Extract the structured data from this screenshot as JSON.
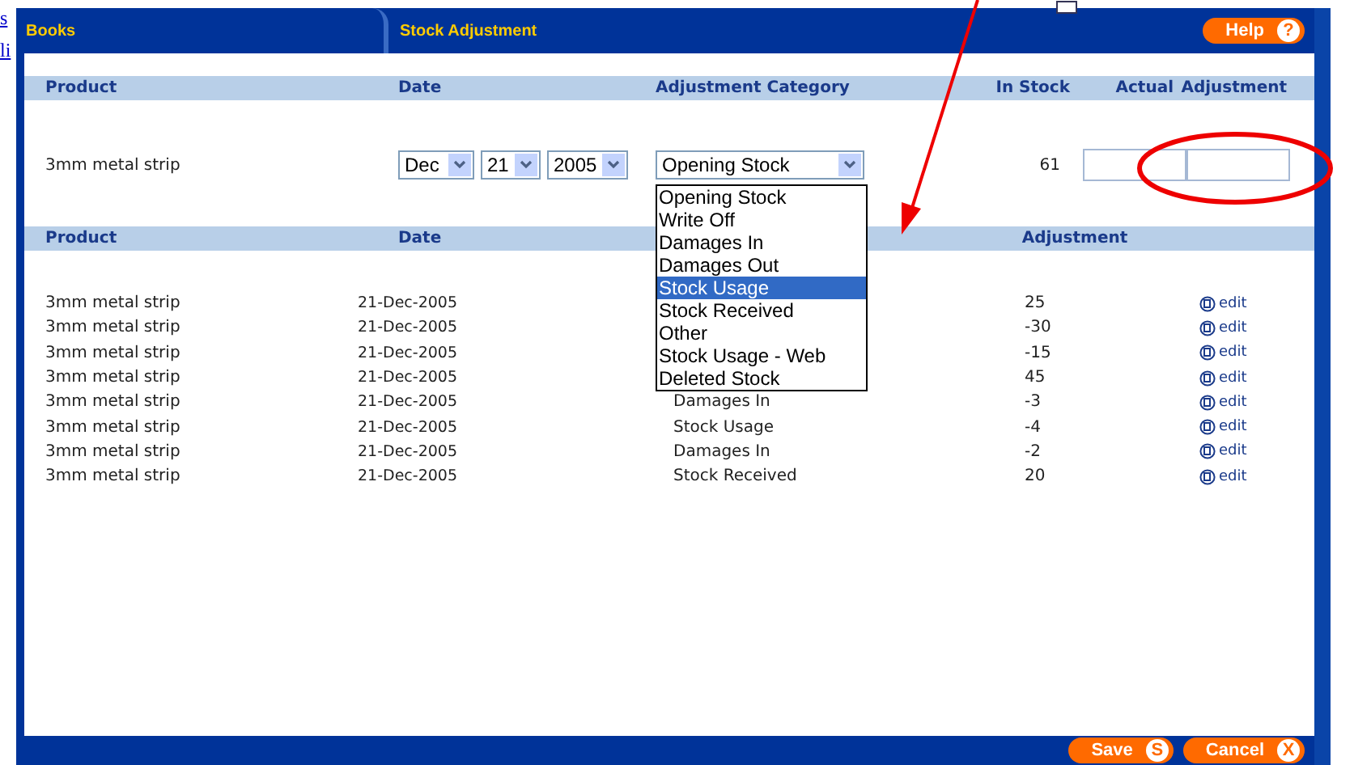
{
  "background_links": [
    "s",
    "li"
  ],
  "tabs": [
    {
      "label": "Books"
    },
    {
      "label": "Stock Adjustment"
    }
  ],
  "help_button": {
    "label": "Help",
    "key": "?"
  },
  "entry": {
    "columns": [
      "Product",
      "Date",
      "Adjustment Category",
      "In Stock",
      "Actual",
      "Adjustment"
    ],
    "product": "3mm metal strip",
    "month": "Dec",
    "day": "21",
    "year": "2005",
    "category": "Opening Stock",
    "in_stock": "61",
    "options": [
      {
        "label": "Opening Stock",
        "selected": false
      },
      {
        "label": "Write Off",
        "selected": false
      },
      {
        "label": "Damages In",
        "selected": false
      },
      {
        "label": "Damages Out",
        "selected": false
      },
      {
        "label": "Stock Usage",
        "selected": true
      },
      {
        "label": "Stock Received",
        "selected": false
      },
      {
        "label": "Other",
        "selected": false
      },
      {
        "label": "Stock Usage - Web",
        "selected": false
      },
      {
        "label": "Deleted Stock",
        "selected": false
      }
    ]
  },
  "history": {
    "columns": [
      "Product",
      "Date",
      "Adjustment"
    ],
    "rows": [
      {
        "product": "3mm metal strip",
        "date": "21-Dec-2005",
        "adjustment": "25",
        "action": "edit"
      },
      {
        "product": "3mm metal strip",
        "date": "21-Dec-2005",
        "adjustment": "-30",
        "action": "edit"
      },
      {
        "product": "3mm metal strip",
        "date": "21-Dec-2005",
        "adjustment": "-15",
        "action": "edit"
      },
      {
        "product": "3mm metal strip",
        "date": "21-Dec-2005",
        "adjustment": "45",
        "action": "edit"
      },
      {
        "product": "3mm metal strip",
        "date": "21-Dec-2005",
        "category": "Damages In",
        "adjustment": "-3",
        "action": "edit"
      },
      {
        "product": "3mm metal strip",
        "date": "21-Dec-2005",
        "category": "Stock Usage",
        "adjustment": "-4",
        "action": "edit"
      },
      {
        "product": "3mm metal strip",
        "date": "21-Dec-2005",
        "category": "Damages In",
        "adjustment": "-2",
        "action": "edit"
      },
      {
        "product": "3mm metal strip",
        "date": "21-Dec-2005",
        "category": "Stock Received",
        "adjustment": "20",
        "action": "edit"
      }
    ]
  },
  "buttons": [
    {
      "label": "Save",
      "key": "S"
    },
    {
      "label": "Cancel",
      "key": "X"
    }
  ]
}
